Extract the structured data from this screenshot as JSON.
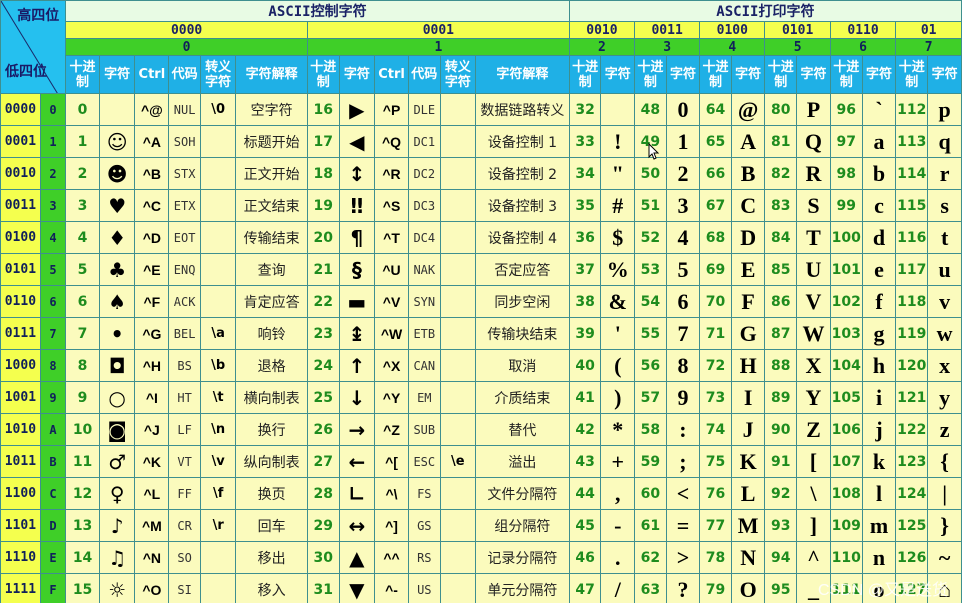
{
  "corner": {
    "high": "高四位",
    "low": "低四位"
  },
  "titles": {
    "control": "ASCII控制字符",
    "printable": "ASCII打印字符"
  },
  "column_groups": [
    {
      "bin": "0000",
      "hex": "0",
      "type": "control"
    },
    {
      "bin": "0001",
      "hex": "1",
      "type": "control"
    },
    {
      "bin": "0010",
      "hex": "2",
      "type": "print"
    },
    {
      "bin": "0011",
      "hex": "3",
      "type": "print"
    },
    {
      "bin": "0100",
      "hex": "4",
      "type": "print"
    },
    {
      "bin": "0101",
      "hex": "5",
      "type": "print"
    },
    {
      "bin": "0110",
      "hex": "6",
      "type": "print"
    },
    {
      "bin": "01",
      "hex": "7",
      "type": "print"
    }
  ],
  "headers": {
    "dec": "十进制",
    "char": "字符",
    "ctrl": "Ctrl",
    "code": "代码",
    "escape": "转义字符",
    "desc": "字符解释"
  },
  "rows": [
    {
      "bin": "0000",
      "hex": "0",
      "g0": {
        "dec": "0",
        "char": "",
        "ctrl": "^@",
        "code": "NUL",
        "esc": "\\0",
        "desc": "空字符"
      },
      "g1": {
        "dec": "16",
        "char": "▶",
        "ctrl": "^P",
        "code": "DLE",
        "esc": "",
        "desc": "数据链路转义"
      },
      "p": [
        [
          "32",
          ""
        ],
        [
          "48",
          "0"
        ],
        [
          "64",
          "@"
        ],
        [
          "80",
          "P"
        ],
        [
          "96",
          "`"
        ],
        [
          "112",
          "p"
        ]
      ]
    },
    {
      "bin": "0001",
      "hex": "1",
      "g0": {
        "dec": "1",
        "char": "☺",
        "ctrl": "^A",
        "code": "SOH",
        "esc": "",
        "desc": "标题开始"
      },
      "g1": {
        "dec": "17",
        "char": "◀",
        "ctrl": "^Q",
        "code": "DC1",
        "esc": "",
        "desc": "设备控制 1"
      },
      "p": [
        [
          "33",
          "!"
        ],
        [
          "49",
          "1"
        ],
        [
          "65",
          "A"
        ],
        [
          "81",
          "Q"
        ],
        [
          "97",
          "a"
        ],
        [
          "113",
          "q"
        ]
      ]
    },
    {
      "bin": "0010",
      "hex": "2",
      "g0": {
        "dec": "2",
        "char": "☻",
        "ctrl": "^B",
        "code": "STX",
        "esc": "",
        "desc": "正文开始"
      },
      "g1": {
        "dec": "18",
        "char": "↕",
        "ctrl": "^R",
        "code": "DC2",
        "esc": "",
        "desc": "设备控制 2"
      },
      "p": [
        [
          "34",
          "\""
        ],
        [
          "50",
          "2"
        ],
        [
          "66",
          "B"
        ],
        [
          "82",
          "R"
        ],
        [
          "98",
          "b"
        ],
        [
          "114",
          "r"
        ]
      ]
    },
    {
      "bin": "0011",
      "hex": "3",
      "g0": {
        "dec": "3",
        "char": "♥",
        "ctrl": "^C",
        "code": "ETX",
        "esc": "",
        "desc": "正文结束"
      },
      "g1": {
        "dec": "19",
        "char": "‼",
        "ctrl": "^S",
        "code": "DC3",
        "esc": "",
        "desc": "设备控制 3"
      },
      "p": [
        [
          "35",
          "#"
        ],
        [
          "51",
          "3"
        ],
        [
          "67",
          "C"
        ],
        [
          "83",
          "S"
        ],
        [
          "99",
          "c"
        ],
        [
          "115",
          "s"
        ]
      ]
    },
    {
      "bin": "0100",
      "hex": "4",
      "g0": {
        "dec": "4",
        "char": "♦",
        "ctrl": "^D",
        "code": "EOT",
        "esc": "",
        "desc": "传输结束"
      },
      "g1": {
        "dec": "20",
        "char": "¶",
        "ctrl": "^T",
        "code": "DC4",
        "esc": "",
        "desc": "设备控制 4"
      },
      "p": [
        [
          "36",
          "$"
        ],
        [
          "52",
          "4"
        ],
        [
          "68",
          "D"
        ],
        [
          "84",
          "T"
        ],
        [
          "100",
          "d"
        ],
        [
          "116",
          "t"
        ]
      ]
    },
    {
      "bin": "0101",
      "hex": "5",
      "g0": {
        "dec": "5",
        "char": "♣",
        "ctrl": "^E",
        "code": "ENQ",
        "esc": "",
        "desc": "查询"
      },
      "g1": {
        "dec": "21",
        "char": "§",
        "ctrl": "^U",
        "code": "NAK",
        "esc": "",
        "desc": "否定应答"
      },
      "p": [
        [
          "37",
          "%"
        ],
        [
          "53",
          "5"
        ],
        [
          "69",
          "E"
        ],
        [
          "85",
          "U"
        ],
        [
          "101",
          "e"
        ],
        [
          "117",
          "u"
        ]
      ]
    },
    {
      "bin": "0110",
      "hex": "6",
      "g0": {
        "dec": "6",
        "char": "♠",
        "ctrl": "^F",
        "code": "ACK",
        "esc": "",
        "desc": "肯定应答"
      },
      "g1": {
        "dec": "22",
        "char": "▬",
        "ctrl": "^V",
        "code": "SYN",
        "esc": "",
        "desc": "同步空闲"
      },
      "p": [
        [
          "38",
          "&"
        ],
        [
          "54",
          "6"
        ],
        [
          "70",
          "F"
        ],
        [
          "86",
          "V"
        ],
        [
          "102",
          "f"
        ],
        [
          "118",
          "v"
        ]
      ]
    },
    {
      "bin": "0111",
      "hex": "7",
      "g0": {
        "dec": "7",
        "char": "•",
        "ctrl": "^G",
        "code": "BEL",
        "esc": "\\a",
        "desc": "响铃"
      },
      "g1": {
        "dec": "23",
        "char": "↨",
        "ctrl": "^W",
        "code": "ETB",
        "esc": "",
        "desc": "传输块结束"
      },
      "p": [
        [
          "39",
          "'"
        ],
        [
          "55",
          "7"
        ],
        [
          "71",
          "G"
        ],
        [
          "87",
          "W"
        ],
        [
          "103",
          "g"
        ],
        [
          "119",
          "w"
        ]
      ]
    },
    {
      "bin": "1000",
      "hex": "8",
      "g0": {
        "dec": "8",
        "char": "◘",
        "ctrl": "^H",
        "code": "BS",
        "esc": "\\b",
        "desc": "退格"
      },
      "g1": {
        "dec": "24",
        "char": "↑",
        "ctrl": "^X",
        "code": "CAN",
        "esc": "",
        "desc": "取消"
      },
      "p": [
        [
          "40",
          "("
        ],
        [
          "56",
          "8"
        ],
        [
          "72",
          "H"
        ],
        [
          "88",
          "X"
        ],
        [
          "104",
          "h"
        ],
        [
          "120",
          "x"
        ]
      ]
    },
    {
      "bin": "1001",
      "hex": "9",
      "g0": {
        "dec": "9",
        "char": "○",
        "ctrl": "^I",
        "code": "HT",
        "esc": "\\t",
        "desc": "横向制表"
      },
      "g1": {
        "dec": "25",
        "char": "↓",
        "ctrl": "^Y",
        "code": "EM",
        "esc": "",
        "desc": "介质结束"
      },
      "p": [
        [
          "41",
          ")"
        ],
        [
          "57",
          "9"
        ],
        [
          "73",
          "I"
        ],
        [
          "89",
          "Y"
        ],
        [
          "105",
          "i"
        ],
        [
          "121",
          "y"
        ]
      ]
    },
    {
      "bin": "1010",
      "hex": "A",
      "g0": {
        "dec": "10",
        "char": "◙",
        "ctrl": "^J",
        "code": "LF",
        "esc": "\\n",
        "desc": "换行"
      },
      "g1": {
        "dec": "26",
        "char": "→",
        "ctrl": "^Z",
        "code": "SUB",
        "esc": "",
        "desc": "替代"
      },
      "p": [
        [
          "42",
          "*"
        ],
        [
          "58",
          ":"
        ],
        [
          "74",
          "J"
        ],
        [
          "90",
          "Z"
        ],
        [
          "106",
          "j"
        ],
        [
          "122",
          "z"
        ]
      ]
    },
    {
      "bin": "1011",
      "hex": "B",
      "g0": {
        "dec": "11",
        "char": "♂",
        "ctrl": "^K",
        "code": "VT",
        "esc": "\\v",
        "desc": "纵向制表"
      },
      "g1": {
        "dec": "27",
        "char": "←",
        "ctrl": "^[",
        "code": "ESC",
        "esc": "\\e",
        "desc": "溢出"
      },
      "p": [
        [
          "43",
          "+"
        ],
        [
          "59",
          ";"
        ],
        [
          "75",
          "K"
        ],
        [
          "91",
          "["
        ],
        [
          "107",
          "k"
        ],
        [
          "123",
          "{"
        ]
      ]
    },
    {
      "bin": "1100",
      "hex": "C",
      "g0": {
        "dec": "12",
        "char": "♀",
        "ctrl": "^L",
        "code": "FF",
        "esc": "\\f",
        "desc": "换页"
      },
      "g1": {
        "dec": "28",
        "char": "∟",
        "ctrl": "^\\",
        "code": "FS",
        "esc": "",
        "desc": "文件分隔符"
      },
      "p": [
        [
          "44",
          ","
        ],
        [
          "60",
          "<"
        ],
        [
          "76",
          "L"
        ],
        [
          "92",
          "\\"
        ],
        [
          "108",
          "l"
        ],
        [
          "124",
          "|"
        ]
      ]
    },
    {
      "bin": "1101",
      "hex": "D",
      "g0": {
        "dec": "13",
        "char": "♪",
        "ctrl": "^M",
        "code": "CR",
        "esc": "\\r",
        "desc": "回车"
      },
      "g1": {
        "dec": "29",
        "char": "↔",
        "ctrl": "^]",
        "code": "GS",
        "esc": "",
        "desc": "组分隔符"
      },
      "p": [
        [
          "45",
          "-"
        ],
        [
          "61",
          "="
        ],
        [
          "77",
          "M"
        ],
        [
          "93",
          "]"
        ],
        [
          "109",
          "m"
        ],
        [
          "125",
          "}"
        ]
      ]
    },
    {
      "bin": "1110",
      "hex": "E",
      "g0": {
        "dec": "14",
        "char": "♫",
        "ctrl": "^N",
        "code": "SO",
        "esc": "",
        "desc": "移出"
      },
      "g1": {
        "dec": "30",
        "char": "▲",
        "ctrl": "^^",
        "code": "RS",
        "esc": "",
        "desc": "记录分隔符"
      },
      "p": [
        [
          "46",
          "."
        ],
        [
          "62",
          ">"
        ],
        [
          "78",
          "N"
        ],
        [
          "94",
          "^"
        ],
        [
          "110",
          "n"
        ],
        [
          "126",
          "~"
        ]
      ]
    },
    {
      "bin": "1111",
      "hex": "F",
      "g0": {
        "dec": "15",
        "char": "☼",
        "ctrl": "^O",
        "code": "SI",
        "esc": "",
        "desc": "移入"
      },
      "g1": {
        "dec": "31",
        "char": "▼",
        "ctrl": "^-",
        "code": "US",
        "esc": "",
        "desc": "单元分隔符"
      },
      "p": [
        [
          "47",
          "/"
        ],
        [
          "63",
          "?"
        ],
        [
          "79",
          "O"
        ],
        [
          "95",
          "_"
        ],
        [
          "111",
          "o"
        ],
        [
          "127",
          "⌂"
        ]
      ]
    }
  ],
  "watermark": "CSDN @又是送货"
}
